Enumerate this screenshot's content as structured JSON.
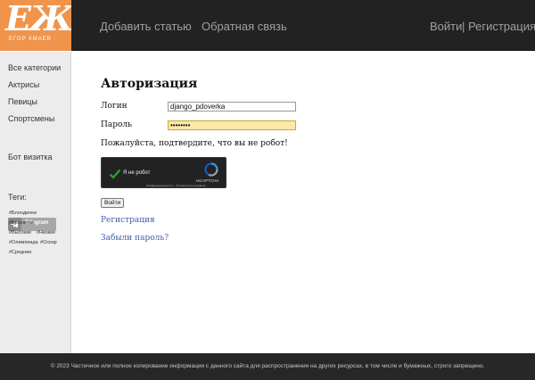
{
  "header": {
    "logo_text": "ЕЖ",
    "logo_subtitle": "ЕГОР КМАЕВ",
    "nav": [
      "Добавить статью",
      "Обратная связь"
    ],
    "auth_login": "Войти",
    "auth_separator": "|",
    "auth_register": "Регистрация"
  },
  "sidebar": {
    "categories": [
      "Все категории",
      "Актрисы",
      "Певицы",
      "Спортсмены"
    ],
    "bot_heading": "Бот визитка",
    "telegram_label": "Telegram",
    "tags_heading": "Теги:",
    "tags": [
      "#Блондинки",
      "#Брюнетки",
      "#Высокие",
      "#Низкие",
      "#Олимпиада",
      "#Оскар",
      "#Средние"
    ]
  },
  "main": {
    "title": "Авторизация",
    "login_label": "Логин",
    "login_value": "django_pdoverka",
    "password_label": "Пароль",
    "password_value": "••••••••",
    "robot_notice": "Пожалуйста, подтвердите, что вы не робот!",
    "captcha": {
      "label": "Я не робот",
      "brand": "reCAPTCHA",
      "privacy": "Конфиденциальность - Условия использования"
    },
    "submit_label": "Войти",
    "register_link": "Регистрация",
    "forgot_link": "Забыли пароль?"
  },
  "footer": {
    "text": "© 2023 Частичное или полное копирование информации с данного сайта для распространения на других ресурсах, в том числе и бумажных, строго запрещено."
  },
  "colors": {
    "header_bg": "#222222",
    "logo_bg": "#f0944c",
    "link": "#3b5fa8",
    "password_bg": "#fbe9a8",
    "captcha_check": "#2e9e3a"
  }
}
